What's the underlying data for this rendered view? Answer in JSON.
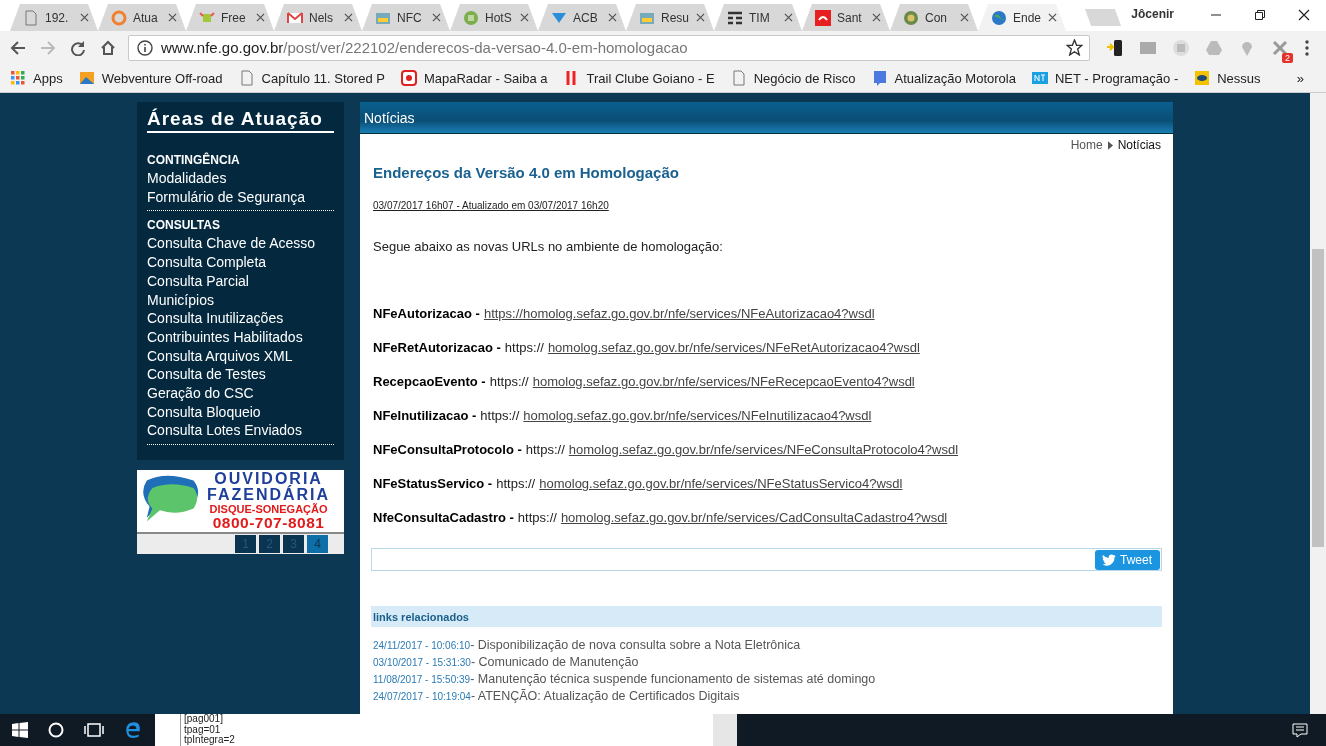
{
  "browser": {
    "tabs": [
      {
        "title": "192.",
        "selected": false
      },
      {
        "title": "Atua",
        "selected": false
      },
      {
        "title": "Free",
        "selected": false
      },
      {
        "title": "Nels",
        "selected": false
      },
      {
        "title": "NFC",
        "selected": false
      },
      {
        "title": "HotS",
        "selected": false
      },
      {
        "title": "ACB",
        "selected": false
      },
      {
        "title": "Resu",
        "selected": false
      },
      {
        "title": "TIM",
        "selected": false
      },
      {
        "title": "Sant",
        "selected": false
      },
      {
        "title": "Con",
        "selected": false
      },
      {
        "title": "Ende",
        "selected": true
      }
    ],
    "profile": "Jôcenir",
    "address": {
      "host": "www.nfe.go.gov.br",
      "path": "/post/ver/222102/enderecos-da-versao-4.0-em-homologacao"
    },
    "extension_badge": "2",
    "bookmarks": [
      "Apps",
      "Webventure Off-road",
      "Capítulo 11. Stored P",
      "MapaRadar - Saiba a",
      "Trail Clube Goiano - E",
      "Negócio de Risco",
      "Atualização Motorola",
      "NET - Programação -",
      "Nessus"
    ],
    "bookmarks_more": "»"
  },
  "sidebar": {
    "title": "Áreas de Atuação",
    "sections": [
      {
        "heading": "CONTINGÊNCIA",
        "items": [
          "Modalidades",
          "Formulário de Segurança"
        ]
      },
      {
        "heading": "CONSULTAS",
        "items": [
          "Consulta Chave de Acesso",
          "Consulta Completa",
          "Consulta Parcial",
          "Municípios",
          "Consulta Inutilizações",
          "Contribuintes Habilitados",
          "Consulta Arquivos XML",
          "Consulta de Testes",
          "Geração do CSC",
          "Consulta Bloqueio",
          "Consulta Lotes Enviados"
        ]
      }
    ],
    "banner": {
      "title": "OUVIDORIA",
      "subtitle": "FAZENDÁRIA",
      "tagline": "DISQUE-SONEGAÇÃO",
      "phone": "0800-707-8081"
    },
    "pages": [
      {
        "label": "1",
        "selected": false
      },
      {
        "label": "2",
        "selected": false
      },
      {
        "label": "3",
        "selected": false
      },
      {
        "label": "4",
        "selected": true
      }
    ]
  },
  "panel": {
    "title": "Notícias",
    "breadcrumb": [
      "Home",
      "Notícias"
    ],
    "article": {
      "title": "Endereços da Versão 4.0 em Homologação",
      "dateline": "03/07/2017 16h07 - Atualizado em 03/07/2017 16h20",
      "intro": "Segue abaixo as novas URLs no ambiente de homologação:",
      "services": [
        {
          "name": "NFeAutorizacao -",
          "url": "https://homolog.sefaz.go.gov.br/nfe/services/NFeAutorizacao4?wsdl"
        },
        {
          "name": "NFeRetAutorizacao -",
          "prefix": "https://",
          "url": "homolog.sefaz.go.gov.br/nfe/services/NFeRetAutorizacao4?wsdl"
        },
        {
          "name": "RecepcaoEvento -",
          "prefix": "https://",
          "url": "homolog.sefaz.go.gov.br/nfe/services/NFeRecepcaoEvento4?wsdl"
        },
        {
          "name": "NFeInutilizacao -",
          "prefix": "https://",
          "url": "homolog.sefaz.go.gov.br/nfe/services/NFeInutilizacao4?wsdl"
        },
        {
          "name": "NFeConsultaProtocolo -",
          "prefix": "https://",
          "url": "homolog.sefaz.go.gov.br/nfe/services/NFeConsultaProtocolo4?wsdl"
        },
        {
          "name": "NFeStatusServico -",
          "prefix": "https://",
          "url": "homolog.sefaz.go.gov.br/nfe/services/NFeStatusServico4?wsdl"
        },
        {
          "name": "NfeConsultaCadastro -",
          "prefix": "https://",
          "url": "homolog.sefaz.go.gov.br/nfe/services/CadConsultaCadastro4?wsdl"
        }
      ]
    },
    "tweet": "Tweet",
    "related": {
      "heading": "links relacionados",
      "items": [
        {
          "date": "24/11/2017 - 10:06:10",
          "text": "- Disponibilização de nova consulta sobre a Nota Eletrônica"
        },
        {
          "date": "03/10/2017 - 15:31:30",
          "text": "- Comunicado de Manutenção"
        },
        {
          "date": "11/08/2017 - 15:50:39",
          "text": "- Manutenção técnica suspende funcionamento de sistemas até domingo"
        },
        {
          "date": "24/07/2017 - 10:19:04",
          "text": "- ATENÇÃO: Atualização de Certificados Digitais"
        }
      ]
    }
  },
  "taskbar": {
    "window_lines": [
      "[pag001]",
      "tpag=01",
      "tpIntegra=2"
    ]
  }
}
